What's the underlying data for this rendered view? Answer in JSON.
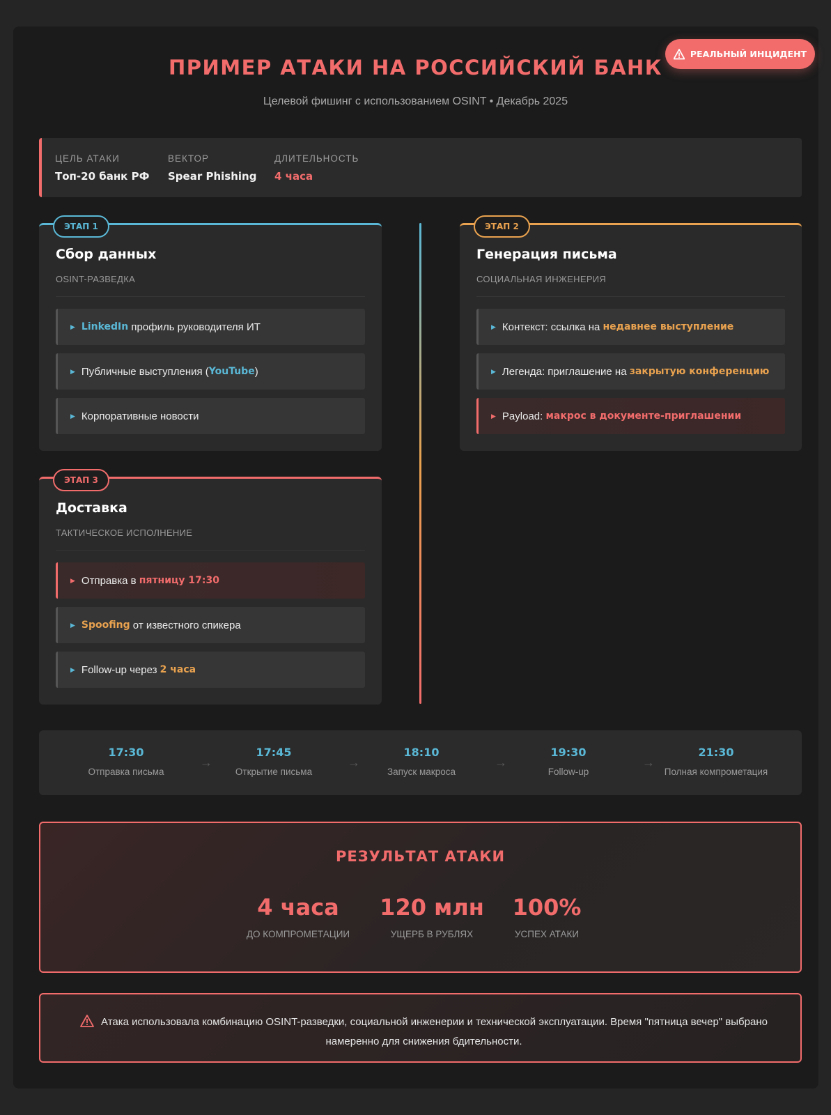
{
  "badge": {
    "label": "РЕАЛЬНЫЙ ИНЦИДЕНТ",
    "icon": "warning-icon"
  },
  "header": {
    "title": "ПРИМЕР АТАКИ НА РОССИЙСКИЙ БАНК",
    "subtitle": "Целевой фишинг с использованием OSINT • Декабрь 2025"
  },
  "meta": [
    {
      "label": "Цель атаки",
      "value": "Топ-20 банк РФ"
    },
    {
      "label": "Вектор",
      "value": "Spear Phishing"
    },
    {
      "label": "Длительность",
      "value": "4 часа"
    }
  ],
  "stages": {
    "s1": {
      "pill": "ЭТАП 1",
      "title": "Сбор данных",
      "subtitle": "OSINT-разведка",
      "items": [
        {
          "a": "LinkedIn",
          "b": " профиль руководителя ИТ"
        },
        {
          "a": "Публичные выступления (",
          "b": "YouTube",
          "c": ")"
        },
        {
          "a": "Корпоративные новости"
        }
      ]
    },
    "s2": {
      "pill": "ЭТАП 2",
      "title": "Генерация письма",
      "subtitle": "Социальная инженерия",
      "items": [
        {
          "a": "Контекст: ссылка на ",
          "b": "недавнее выступление"
        },
        {
          "a": "Легенда: приглашение на ",
          "b": "закрытую конференцию"
        },
        {
          "a": "Payload: ",
          "b": "макрос в документе-приглашении"
        }
      ]
    },
    "s3": {
      "pill": "ЭТАП 3",
      "title": "Доставка",
      "subtitle": "Тактическое исполнение",
      "items": [
        {
          "a": "Отправка в ",
          "b": "пятницу 17:30"
        },
        {
          "a": "Spoofing",
          "b": " от известного спикера"
        },
        {
          "a": "Follow-up через ",
          "b": "2 часа"
        }
      ]
    }
  },
  "timeline": [
    {
      "time": "17:30",
      "label": "Отправка письма"
    },
    {
      "time": "17:45",
      "label": "Открытие письма"
    },
    {
      "time": "18:10",
      "label": "Запуск макроса"
    },
    {
      "time": "19:30",
      "label": "Follow-up"
    },
    {
      "time": "21:30",
      "label": "Полная компрометация"
    }
  ],
  "timeline_arrow": "→",
  "result": {
    "title": "РЕЗУЛЬТАТ АТАКИ",
    "stats": [
      {
        "value": "4 часа",
        "label": "До компрометации"
      },
      {
        "value": "120 млн",
        "label": "Ущерб в рублях"
      },
      {
        "value": "100%",
        "label": "Успех атаки"
      }
    ]
  },
  "warning": {
    "icon": "warning-icon",
    "text": "Атака использовала комбинацию OSINT-разведки, социальной инженерии и технической эксплуатации. Время \"пятница вечер\" выбрано намеренно для снижения бдительности."
  },
  "colors": {
    "accent_red": "#f26c6c",
    "accent_blue": "#5ab8d6",
    "accent_orange": "#e9a24f"
  }
}
